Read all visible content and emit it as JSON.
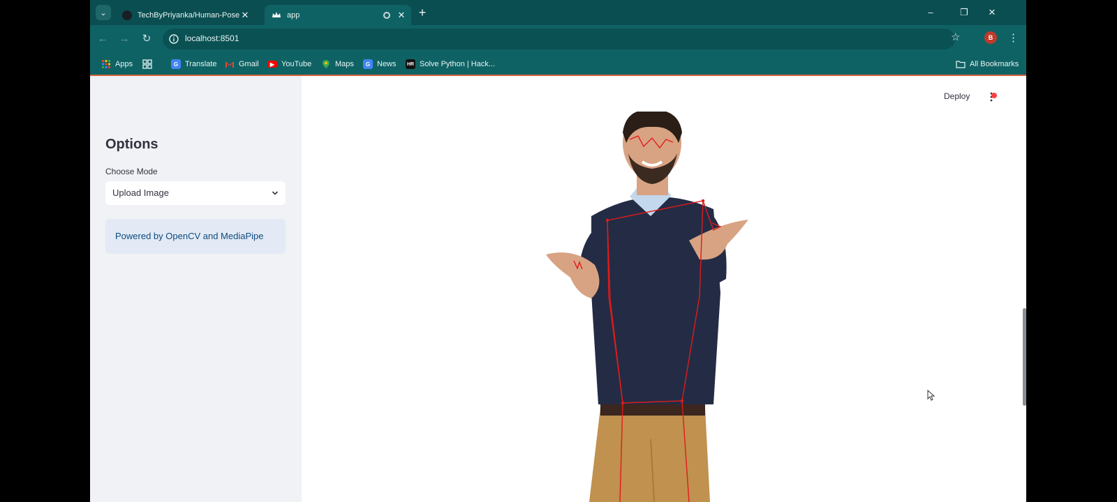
{
  "browser": {
    "tabs": [
      {
        "title": "TechByPriyanka/Human-Pose-E",
        "active": false
      },
      {
        "title": "app",
        "active": true
      }
    ],
    "url": "localhost:8501",
    "profile_initial": "B",
    "bookmarks": [
      {
        "label": "Apps",
        "icon": "apps-grid-icon"
      },
      {
        "label": "",
        "icon": "tab-groups-icon"
      },
      {
        "label": "Translate",
        "icon": "google-translate-icon"
      },
      {
        "label": "Gmail",
        "icon": "gmail-icon"
      },
      {
        "label": "YouTube",
        "icon": "youtube-icon"
      },
      {
        "label": "Maps",
        "icon": "maps-icon"
      },
      {
        "label": "News",
        "icon": "news-icon"
      },
      {
        "label": "Solve Python | Hack...",
        "icon": "hackerrank-icon"
      }
    ],
    "all_bookmarks": "All Bookmarks"
  },
  "sidebar": {
    "title": "Options",
    "mode_label": "Choose Mode",
    "mode_value": "Upload Image",
    "info_text": "Powered by OpenCV and MediaPipe"
  },
  "header": {
    "deploy_label": "Deploy"
  },
  "colors": {
    "titlebar": "#0b4e51",
    "toolbar": "#0f6264",
    "sidebar": "#f0f2f6",
    "info_bg": "#e3eaf5",
    "info_text": "#0c4a7e",
    "pose_lines": "#e01b1b"
  }
}
